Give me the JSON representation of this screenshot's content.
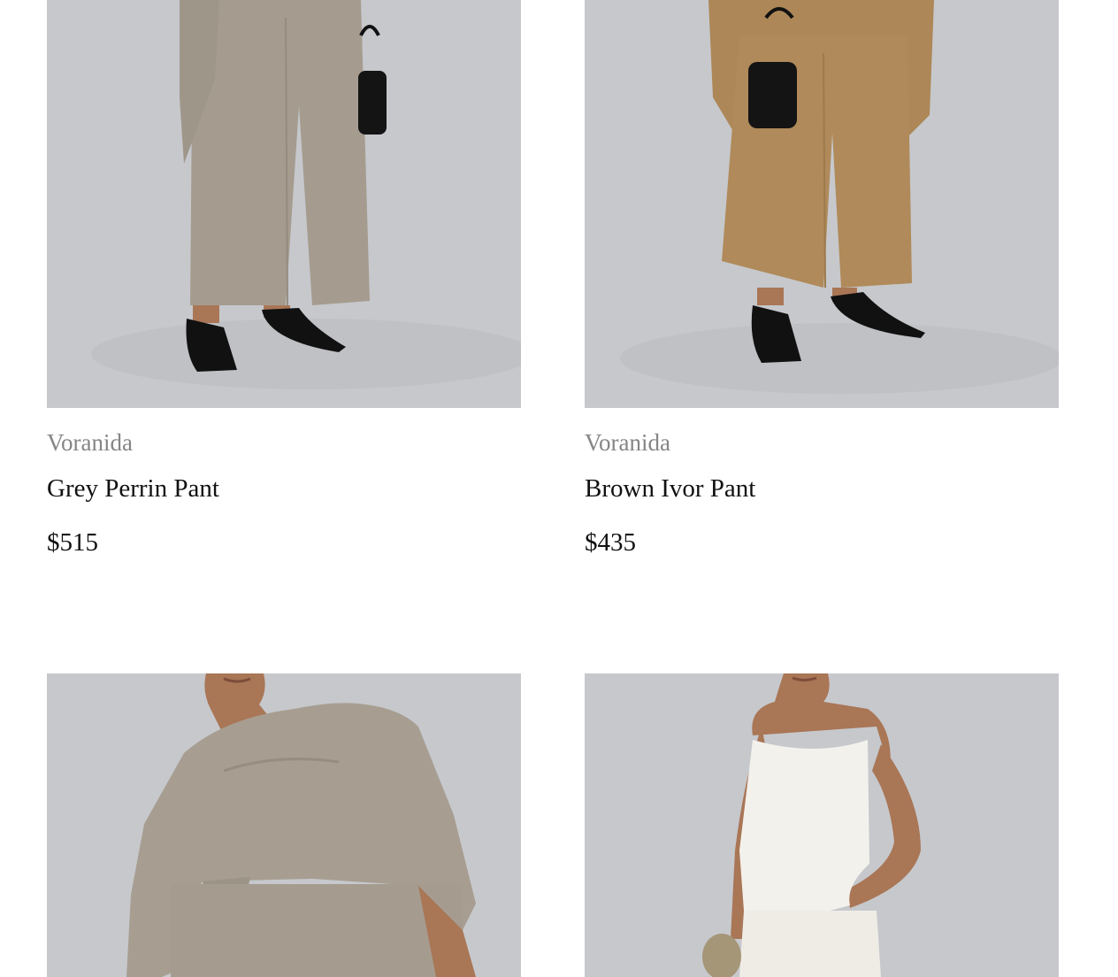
{
  "products": [
    {
      "brand": "Voranida",
      "name": "Grey Perrin Pant",
      "price": "$515",
      "image": "model-grey-wide-leg-pant-black-heels-bag"
    },
    {
      "brand": "Voranida",
      "name": "Brown Ivor Pant",
      "price": "$435",
      "image": "model-camel-wide-leg-pant-black-heels-bag"
    },
    {
      "image": "model-grey-draped-scarf-top"
    },
    {
      "image": "model-white-boucle-strapless-top"
    }
  ],
  "colors": {
    "photo_background": "#c6c8cc",
    "brand_text": "#858585",
    "title_text": "#111111",
    "grey_fabric": "#a59c8f",
    "camel_fabric": "#b08a5a",
    "white_fabric": "#f3f1ec",
    "skin": "#a97656"
  }
}
